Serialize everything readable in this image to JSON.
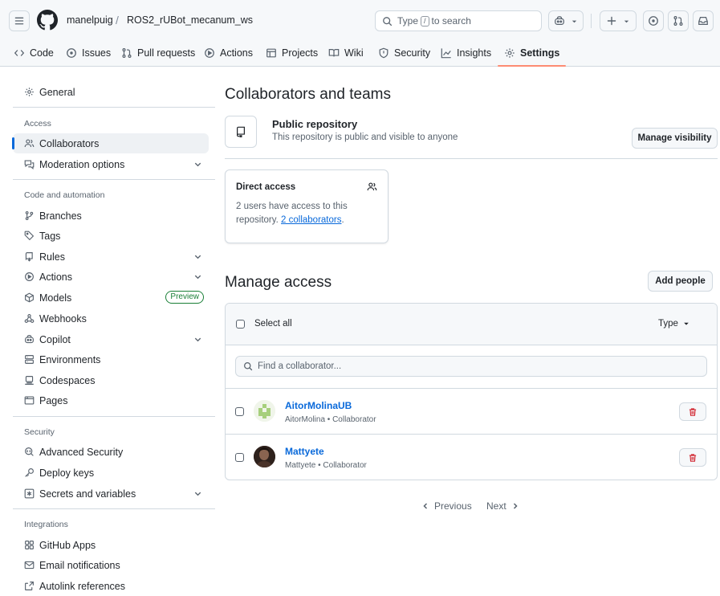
{
  "header": {
    "owner": "manelpuig",
    "separator": "/",
    "repo": "ROS2_rUBot_mecanum_ws",
    "search": {
      "before": "Type",
      "key": "/",
      "after": "to search"
    }
  },
  "tabs": [
    {
      "label": "Code"
    },
    {
      "label": "Issues"
    },
    {
      "label": "Pull requests"
    },
    {
      "label": "Actions"
    },
    {
      "label": "Projects"
    },
    {
      "label": "Wiki"
    },
    {
      "label": "Security"
    },
    {
      "label": "Insights"
    },
    {
      "label": "Settings"
    }
  ],
  "sidebar": {
    "general": "General",
    "headings": {
      "access": "Access",
      "code": "Code and automation",
      "security": "Security",
      "integrations": "Integrations"
    },
    "access": [
      {
        "label": "Collaborators"
      },
      {
        "label": "Moderation options"
      }
    ],
    "code": [
      {
        "label": "Branches"
      },
      {
        "label": "Tags"
      },
      {
        "label": "Rules"
      },
      {
        "label": "Actions"
      },
      {
        "label": "Models",
        "badge": "Preview"
      },
      {
        "label": "Webhooks"
      },
      {
        "label": "Copilot"
      },
      {
        "label": "Environments"
      },
      {
        "label": "Codespaces"
      },
      {
        "label": "Pages"
      }
    ],
    "security": [
      {
        "label": "Advanced Security"
      },
      {
        "label": "Deploy keys"
      },
      {
        "label": "Secrets and variables"
      }
    ],
    "integrations": [
      {
        "label": "GitHub Apps"
      },
      {
        "label": "Email notifications"
      },
      {
        "label": "Autolink references"
      }
    ]
  },
  "main": {
    "title": "Collaborators and teams",
    "visibility": {
      "title": "Public repository",
      "desc": "This repository is public and visible to anyone",
      "button": "Manage visibility"
    },
    "direct_access": {
      "title": "Direct access",
      "text": "2 users have access to this repository.",
      "link": "2 collaborators",
      "suffix": "."
    },
    "manage": {
      "title": "Manage access",
      "add_button": "Add people",
      "select_all": "Select all",
      "type_label": "Type",
      "search_placeholder": "Find a collaborator...",
      "rows": [
        {
          "name": "AitorMolinaUB",
          "meta": "AitorMolina • Collaborator"
        },
        {
          "name": "Mattyete",
          "meta": "Mattyete • Collaborator"
        }
      ]
    },
    "pagination": {
      "previous": "Previous",
      "next": "Next"
    }
  },
  "colors": {
    "accent": "#0969da",
    "tab_underline": "#fd8c73",
    "danger": "#d1242f",
    "badge": "#1a7f37"
  }
}
